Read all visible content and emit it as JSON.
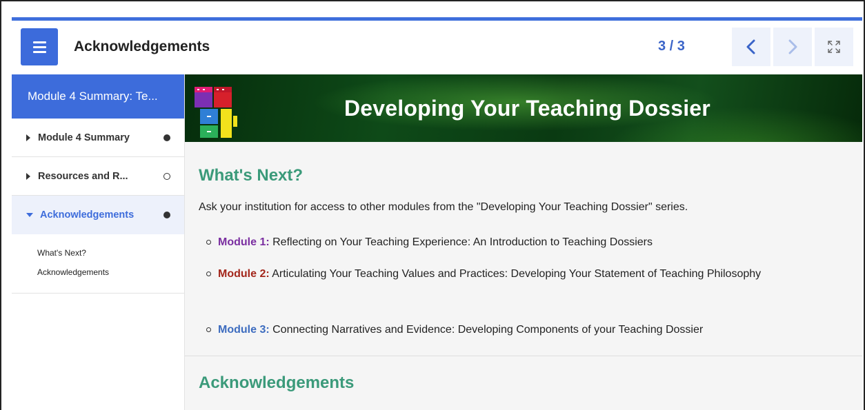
{
  "header": {
    "title": "Acknowledgements",
    "page_indicator": "3 / 3",
    "icons": {
      "menu": "menu-icon",
      "prev": "chevron-left-icon",
      "next": "chevron-right-icon",
      "fullscreen": "fullscreen-icon"
    }
  },
  "sidebar": {
    "heading": "Module 4 Summary: Te...",
    "items": [
      {
        "label": "Module 4 Summary",
        "status": "complete"
      },
      {
        "label": "Resources and R...",
        "status": "incomplete"
      },
      {
        "label": "Acknowledgements",
        "status": "complete",
        "expanded": true
      }
    ],
    "sub_items": [
      "What's Next?",
      "Acknowledgements"
    ]
  },
  "banner": {
    "title": "Developing Your Teaching Dossier"
  },
  "content": {
    "next_heading": "What's Next?",
    "intro": "Ask your institution for access to other modules from the \"Developing Your Teaching Dossier\" series.",
    "modules": [
      {
        "label": "Module 1:",
        "text": " Reflecting on Your Teaching Experience: An Introduction to Teaching Dossiers",
        "color": "#7a2ea0"
      },
      {
        "label": "Module 2:",
        "text": " Articulating Your Teaching Values and Practices: Developing Your Statement of Teaching Philosophy",
        "color": "#a3261b"
      },
      {
        "label": "Module 3:",
        "text": " Connecting Narratives and Evidence: Developing Components of your Teaching Dossier",
        "color": "#3d6cbf"
      }
    ],
    "ack_heading": "Acknowledgements"
  },
  "colors": {
    "accent": "#3d6cdb",
    "heading_green": "#3b9a7a",
    "page_indicator": "#3a64c8"
  }
}
